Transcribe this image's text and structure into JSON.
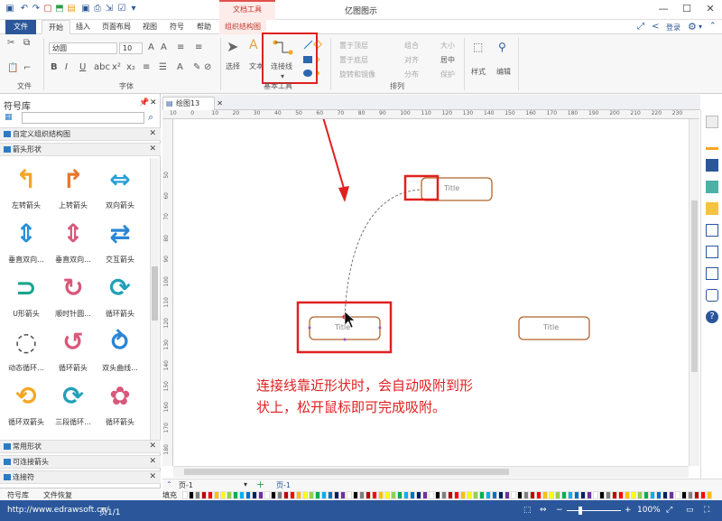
{
  "window": {
    "app_title": "亿图图示",
    "context_tab_label": "文档工具",
    "login_label": "登录"
  },
  "tabs": {
    "file": "文件",
    "start": "开始",
    "insert": "插入",
    "page_layout": "页面布局",
    "view": "视图",
    "symbol": "符号",
    "help": "帮助",
    "org_chart": "组织结构图"
  },
  "ribbon": {
    "font_name": "幼圆",
    "font_size": "10",
    "group_file": "文件",
    "group_font": "字体",
    "group_basic_tools": "基本工具",
    "group_arrange": "排列",
    "select_label": "选择",
    "text_label": "文本",
    "connector_label": "连接线",
    "bring_front": "置于顶层",
    "send_back": "置于底层",
    "rotate_mirror": "旋转和镜像",
    "group": "组合",
    "align": "对齐",
    "distribute": "分布",
    "size": "大小",
    "center": "居中",
    "protect": "保护",
    "style": "样式",
    "edit": "编辑"
  },
  "library": {
    "title": "符号库",
    "sections_top": [
      "自定义组织结构图",
      "箭头形状"
    ],
    "shapes": [
      {
        "name": "左转箭头",
        "icon": "turn-left-arrow-icon",
        "color": "#f5a623"
      },
      {
        "name": "上转箭头",
        "icon": "turn-up-arrow-icon",
        "color": "#e8772e"
      },
      {
        "name": "双向箭头",
        "icon": "double-arrow-icon",
        "color": "#2a9fd6"
      },
      {
        "name": "垂直双向...",
        "icon": "vertical-double-arrow-icon",
        "color": "#2a8fd6"
      },
      {
        "name": "垂直双向...",
        "icon": "vertical-double-arrow-2-icon",
        "color": "#d9577b"
      },
      {
        "name": "交互箭头",
        "icon": "exchange-arrow-icon",
        "color": "#2a86d6"
      },
      {
        "name": "U形箭头",
        "icon": "u-arrow-icon",
        "color": "#1aa58c"
      },
      {
        "name": "顺时针圆...",
        "icon": "clockwise-arrow-icon",
        "color": "#d9577b"
      },
      {
        "name": "循环箭头",
        "icon": "cycle-arrow-icon",
        "color": "#23a0b8"
      },
      {
        "name": "动态循环...",
        "icon": "dynamic-cycle-icon",
        "color": "#555555"
      },
      {
        "name": "循环箭头",
        "icon": "cycle-arrow-2-icon",
        "color": "#d9577b"
      },
      {
        "name": "双头曲线...",
        "icon": "double-curve-icon",
        "color": "#2a86d6"
      },
      {
        "name": "循环双箭头",
        "icon": "cycle-double-icon",
        "color": "#f5a623"
      },
      {
        "name": "三段循环...",
        "icon": "three-cycle-icon",
        "color": "#23a0b8"
      },
      {
        "name": "循环箭头",
        "icon": "cycle-arrow-3-icon",
        "color": "#d9577b"
      }
    ],
    "sections_bottom": [
      "常用形状",
      "可连接箭头",
      "连接符"
    ],
    "bottom_tabs": [
      "符号库",
      "文件恢复"
    ]
  },
  "document": {
    "tab_name": "绘图13",
    "shape_text": "Title",
    "annotation_line1": "连接线靠近形状时，会自动吸附到形",
    "annotation_line2": "状上，松开鼠标即可完成吸附。",
    "annotation_color": "#e02020"
  },
  "rulers": {
    "h": [
      "10",
      "0",
      "10",
      "20",
      "30",
      "40",
      "50",
      "60",
      "70",
      "80",
      "90",
      "100",
      "110",
      "120",
      "130",
      "140",
      "150",
      "160",
      "170",
      "180",
      "190",
      "200",
      "210",
      "220",
      "230"
    ],
    "v": [
      "50",
      "60",
      "70",
      "80",
      "90",
      "100",
      "110",
      "120",
      "130",
      "140",
      "150",
      "160",
      "170",
      "180"
    ]
  },
  "pagebar": {
    "page_left": "页-1",
    "page_right": "页-1",
    "fill_label": "填充"
  },
  "status": {
    "url": "http://www.edrawsoft.cn/",
    "page_info": "页1/1",
    "zoom": "100%"
  }
}
